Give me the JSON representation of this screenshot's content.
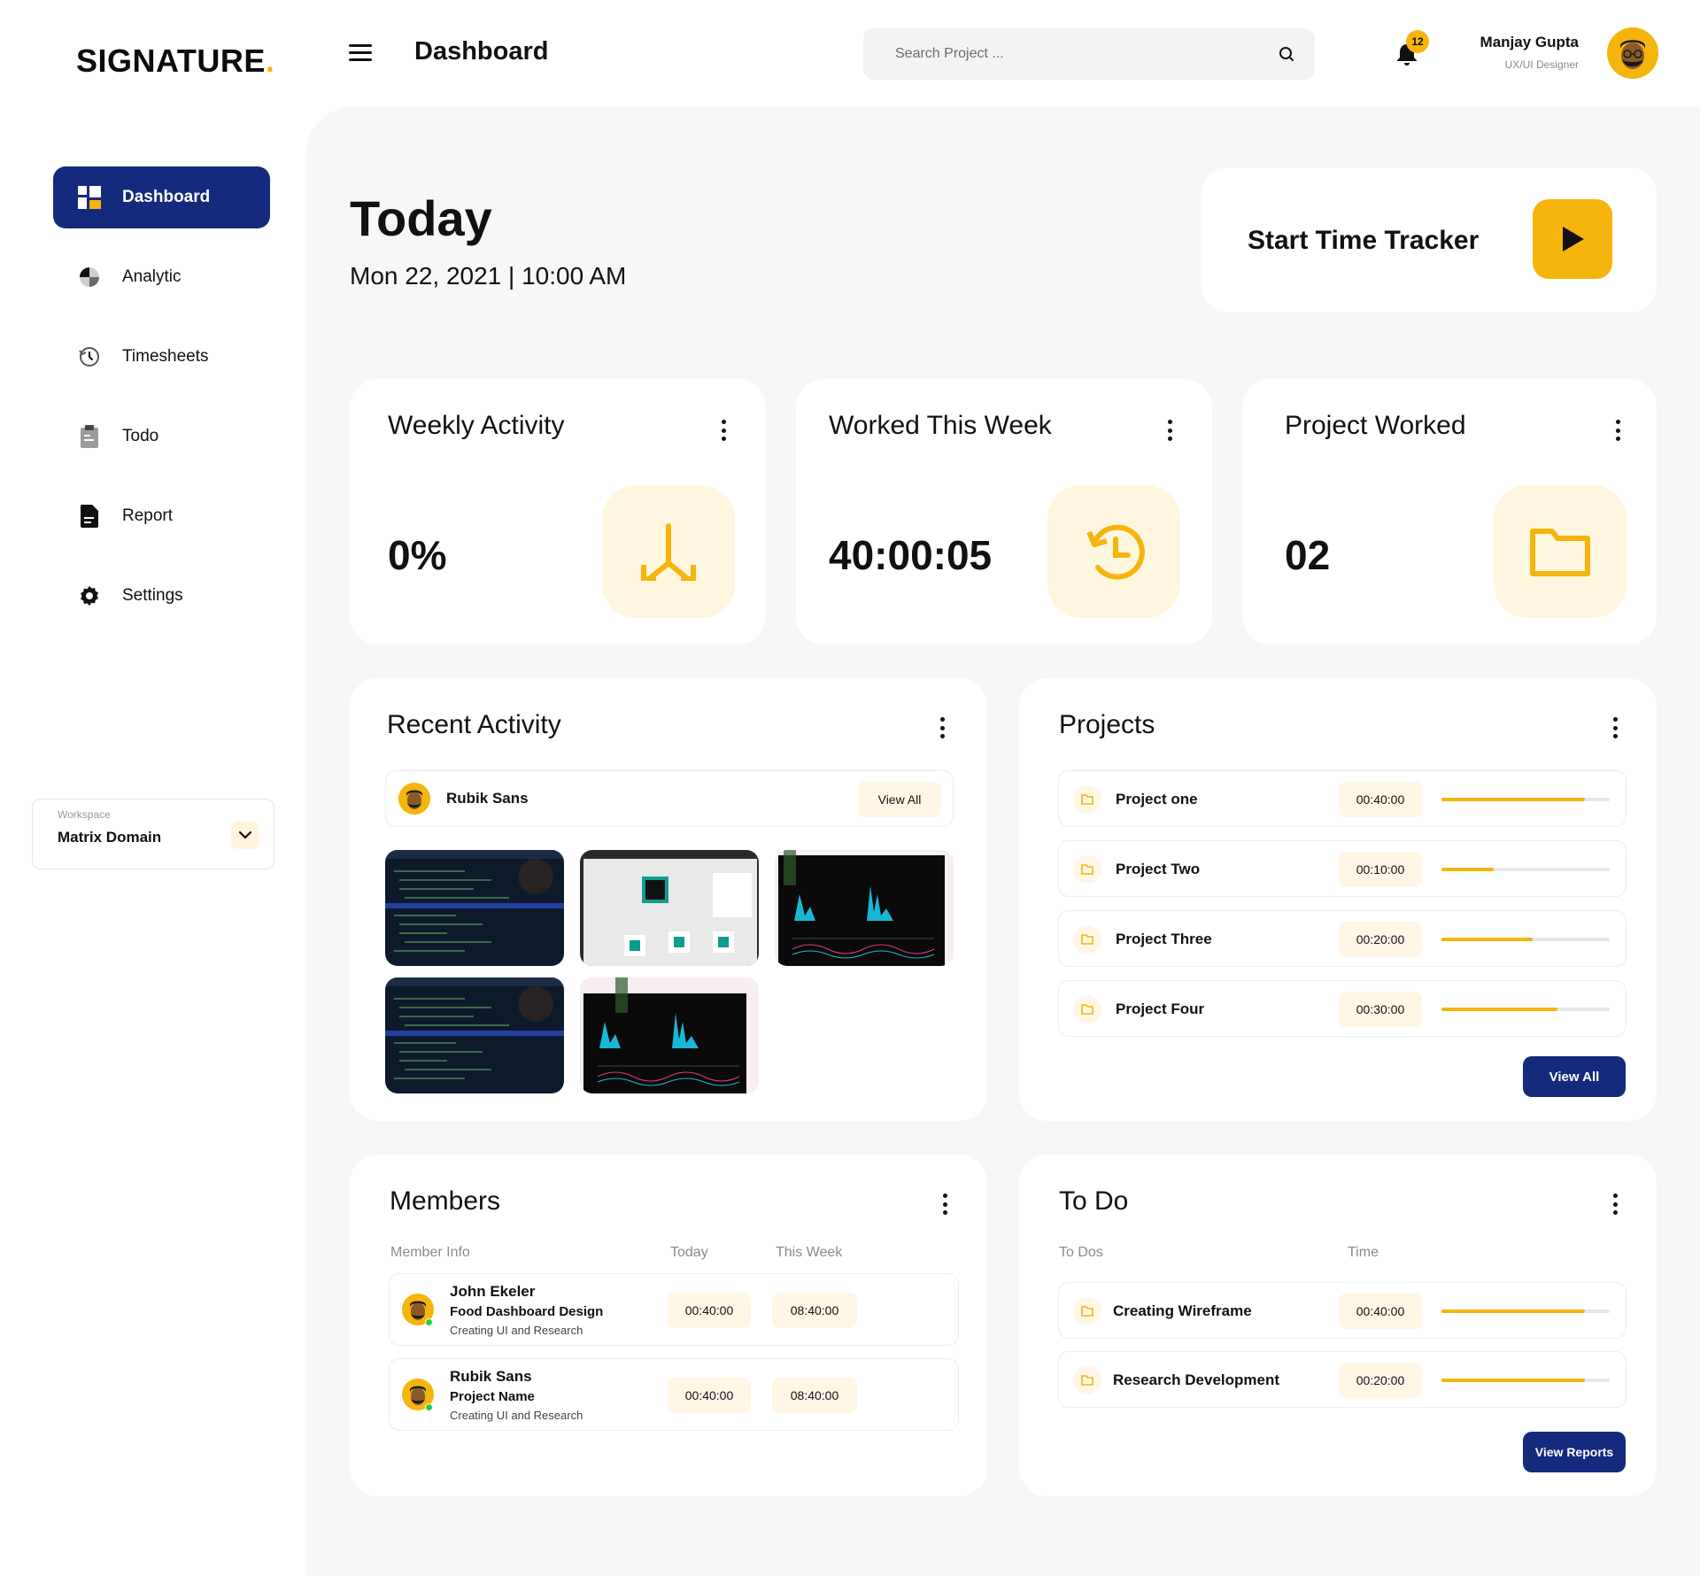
{
  "brand": {
    "name": "SIGNATURE",
    "dot": "."
  },
  "header": {
    "title": "Dashboard",
    "search_placeholder": "Search Project ...",
    "notification_count": "12",
    "user_name": "Manjay Gupta",
    "user_role": "UX/UI Designer"
  },
  "sidebar": {
    "items": [
      {
        "label": "Dashboard",
        "icon": "dashboard-icon",
        "active": true
      },
      {
        "label": "Analytic",
        "icon": "pie-chart-icon"
      },
      {
        "label": "Timesheets",
        "icon": "history-clock-icon"
      },
      {
        "label": "Todo",
        "icon": "clipboard-icon"
      },
      {
        "label": "Report",
        "icon": "document-icon"
      },
      {
        "label": "Settings",
        "icon": "gear-icon"
      }
    ],
    "workspace": {
      "label": "Workspace",
      "value": "Matrix Domain"
    }
  },
  "today": {
    "heading": "Today",
    "date": "Mon 22, 2021 | 10:00 AM"
  },
  "tracker": {
    "label": "Start Time Tracker"
  },
  "stats": [
    {
      "title": "Weekly Activity",
      "value": "0%",
      "icon": "arrows-down-icon"
    },
    {
      "title": "Worked This Week",
      "value": "40:00:05",
      "icon": "clock-icon"
    },
    {
      "title": "Project Worked",
      "value": "02",
      "icon": "folder-icon"
    }
  ],
  "recent_activity": {
    "title": "Recent Activity",
    "user": "Rubik Sans",
    "view_all": "View All"
  },
  "projects": {
    "title": "Projects",
    "rows": [
      {
        "name": "Project one",
        "time": "00:40:00",
        "progress": 0.85
      },
      {
        "name": "Project Two",
        "time": "00:10:00",
        "progress": 0.31
      },
      {
        "name": "Project Three",
        "time": "00:20:00",
        "progress": 0.54
      },
      {
        "name": "Project Four",
        "time": "00:30:00",
        "progress": 0.69
      }
    ],
    "view_all": "View All"
  },
  "members": {
    "title": "Members",
    "columns": [
      "Member Info",
      "Today",
      "This Week"
    ],
    "rows": [
      {
        "name": "John Ekeler",
        "project": "Food Dashboard Design",
        "task": "Creating UI and Research",
        "today": "00:40:00",
        "week": "08:40:00"
      },
      {
        "name": "Rubik Sans",
        "project": "Project Name",
        "task": "Creating UI and Research",
        "today": "00:40:00",
        "week": "08:40:00"
      }
    ]
  },
  "todo": {
    "title": "To Do",
    "columns": [
      "To Dos",
      "Time"
    ],
    "rows": [
      {
        "name": "Creating Wireframe",
        "time": "00:40:00",
        "progress": 0.85
      },
      {
        "name": "Research Development",
        "time": "00:20:00",
        "progress": 0.85
      }
    ],
    "view_reports": "View Reports"
  },
  "colors": {
    "accent": "#f5b50c",
    "primary": "#142a7c",
    "background": "#f7f7f7"
  }
}
